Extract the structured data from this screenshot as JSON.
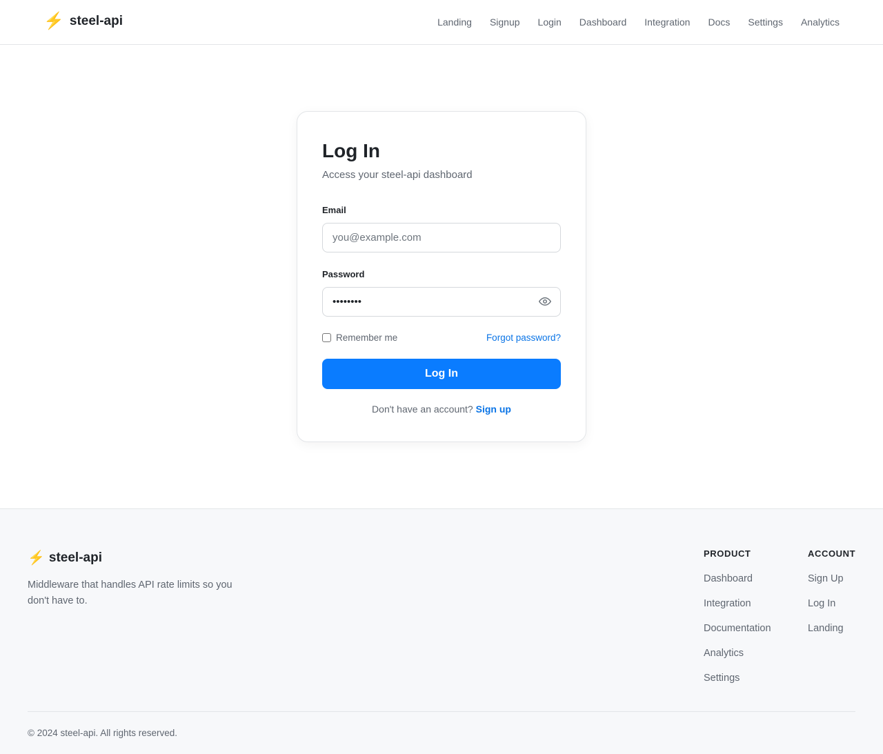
{
  "header": {
    "logo_icon": "lightning-bolt",
    "brand": "steel-api",
    "nav": [
      "Landing",
      "Signup",
      "Login",
      "Dashboard",
      "Integration",
      "Docs",
      "Settings",
      "Analytics"
    ]
  },
  "login": {
    "title": "Log In",
    "subtitle": "Access your steel-api dashboard",
    "email_label": "Email",
    "email_placeholder": "you@example.com",
    "password_label": "Password",
    "password_value": "••••••••",
    "password_toggle_icon": "eye-icon",
    "remember_label": "Remember me",
    "forgot_label": "Forgot password?",
    "submit_label": "Log In",
    "no_account_text": "Don't have an account?",
    "signup_link": "Sign up"
  },
  "footer": {
    "brand": "steel-api",
    "tagline": "Middleware that handles API rate limits so you don't have to.",
    "product": {
      "heading": "PRODUCT",
      "links": [
        "Dashboard",
        "Integration",
        "Documentation",
        "Analytics",
        "Settings"
      ]
    },
    "account": {
      "heading": "ACCOUNT",
      "links": [
        "Sign Up",
        "Log In",
        "Landing"
      ]
    },
    "copyright": "© 2024 steel-api. All rights reserved."
  },
  "colors": {
    "accent": "#0a7cff",
    "link": "#0a74e6",
    "logo_bolt": "#f5b400"
  }
}
